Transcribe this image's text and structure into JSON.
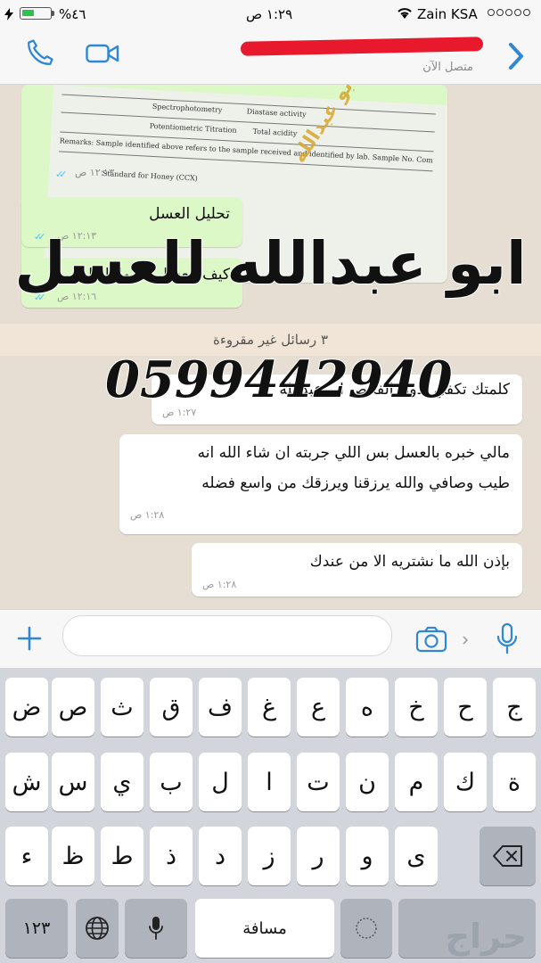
{
  "status_bar": {
    "battery_percent": "%٤٦",
    "battery_level": 0.46,
    "time": "١:٢٩ ص",
    "carrier": "Zain KSA",
    "icons": [
      "charging-bolt-icon",
      "battery-icon",
      "wifi-icon",
      "signal-dots-icon"
    ]
  },
  "header": {
    "contact_status": "متصل الآن",
    "icons": [
      "phone-icon",
      "video-icon",
      "back-chevron-icon"
    ]
  },
  "chat": {
    "image_message": {
      "doc_lines": [
        "Spectrophotometry",
        "Diastase activity",
        "Potentiometric Titration",
        "Total acidity",
        "Remarks: Sample identified above refers to the sample received and identified by lab. Sample No. Computation is in dataset",
        "Standard for Honey (CCX)"
      ],
      "stamp_text": "ابو عبدالله",
      "time": "١٢:١٣ ص"
    },
    "sent_messages": [
      {
        "text": "تحليل العسل",
        "time": "١٢:١٣ ص"
      },
      {
        "text": "كيف العسل ما بها الغالي",
        "time": "١٢:١٦ ص"
      }
    ],
    "unread_banner": "٣ رسائل غير مقروءة",
    "received_messages": [
      {
        "lines": [
          "كلمتك تكفي بدون الفحص ابو عبدالله"
        ],
        "time": "١:٢٧ ص"
      },
      {
        "lines": [
          "مالي خبره بالعسل بس اللي جربته ان شاء الله انه",
          "طيب وصافي والله يرزقنا ويرزقك من واسع فضله"
        ],
        "time": "١:٢٨ ص"
      },
      {
        "lines": [
          "بإذن الله ما نشتريه الا من عندك"
        ],
        "time": "١:٢٨ ص"
      }
    ]
  },
  "overlay": {
    "title": "ابو عبدالله للعسل",
    "phone": "0599442940"
  },
  "input_bar": {
    "placeholder": "",
    "icons": [
      "plus-icon",
      "camera-icon",
      "microphone-icon"
    ]
  },
  "keyboard": {
    "row1": [
      "ج",
      "ح",
      "خ",
      "ه",
      "ع",
      "غ",
      "ف",
      "ق",
      "ث",
      "ص",
      "ض"
    ],
    "row2": [
      "ة",
      "ك",
      "م",
      "ن",
      "ت",
      "ا",
      "ل",
      "ب",
      "ي",
      "س",
      "ش"
    ],
    "row3": [
      "ى",
      "و",
      "ر",
      "ز",
      "د",
      "ذ",
      "ط",
      "ظ",
      "ء"
    ],
    "numbers_key": "١٢٣",
    "space_key": "مسافة",
    "return_key": "",
    "watermark": "حراج"
  }
}
